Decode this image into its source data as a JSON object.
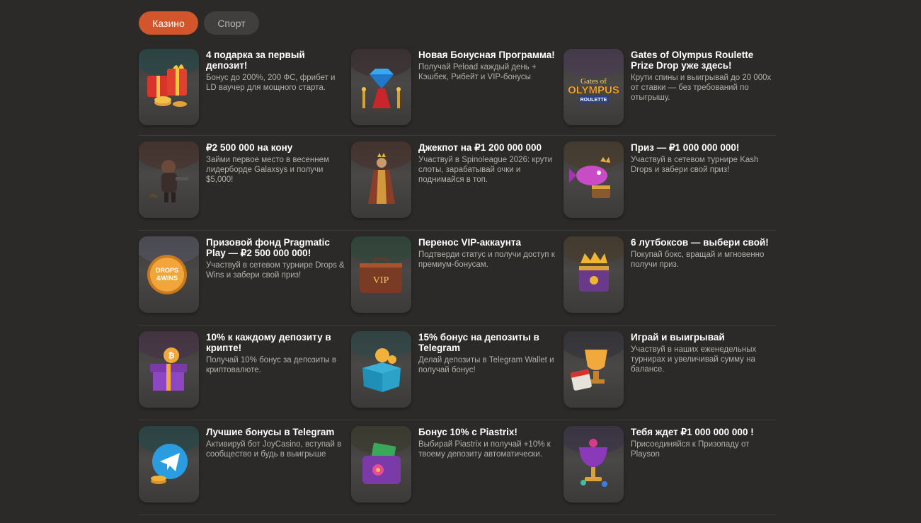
{
  "tabs": {
    "casino": "Казино",
    "sport": "Спорт"
  },
  "cards": [
    {
      "title": "4 подарка за первый депозит!",
      "desc": "Бонус до 200%, 200 ФС, фрибет и LD ваучер для мощного старта.",
      "icon": "gift-boxes-icon"
    },
    {
      "title": "Новая Бонусная Программа!",
      "desc": "Получай Реload каждый день + Кэшбек, Рибейт и VIP-бонусы",
      "icon": "diamond-red-carpet-icon"
    },
    {
      "title": "Gates of Olympus Roulette Prize Drop уже здесь!",
      "desc": "Крути спины и выигрывай до 20 000x от ставки — без требований по отыгрышу.",
      "icon": "olympus-roulette-logo",
      "logo_top": "Gates of",
      "logo_mid": "OLYMPUS",
      "logo_bot": "ROULETTE"
    },
    {
      "title": "₽2 500 000 на кону",
      "desc": "Займи первое место в весеннем лидерборде Galaxsys и получи $5,000!",
      "icon": "character-mascot-icon"
    },
    {
      "title": "Джекпот на ₽1 200 000 000",
      "desc": "Участвуй в Spinoleague 2026: крути слоты, зарабатывай очки и поднимайся в топ.",
      "icon": "queen-figure-icon"
    },
    {
      "title": "Приз — ₽1 000 000 000!",
      "desc": "Участвуй в сетевом турнире Kash Drops и забери свой приз!",
      "icon": "pink-fish-chest-icon"
    },
    {
      "title": "Призовой фонд Pragmatic Play — ₽2 500 000 000!",
      "desc": "Участвуй в сетевом турнире Drops & Wins и забери свой приз!",
      "icon": "drops-wins-coin-icon",
      "logo_top": "DROPS",
      "logo_bot": "&WINS"
    },
    {
      "title": "Перенос VIP-аккаунта",
      "desc": "Подтверди статус и получи доступ к премиум-бонусам.",
      "icon": "vip-suitcase-icon",
      "logo_mid": "VIP"
    },
    {
      "title": "6 лутбоксов — выбери свой!",
      "desc": "Покупай бокс, вращай и мгновенно получи приз.",
      "icon": "crown-lootbox-icon"
    },
    {
      "title": "10% к каждому депозиту в крипте!",
      "desc": "Получай 10% бонус за депозиты в криптовалюте.",
      "icon": "crypto-gift-box-icon"
    },
    {
      "title": "15% бонус на депозиты в Telegram",
      "desc": "Делай депозиты в Telegram Wallet и получай бонус!",
      "icon": "telegram-gift-box-icon"
    },
    {
      "title": "Играй и выигрывай",
      "desc": "Участвуй в наших еженедельных турнирах и увеличивай сумму на балансе.",
      "icon": "trophy-weekly-icon"
    },
    {
      "title": "Лучшие бонусы в Telegram",
      "desc": "Активируй бот JoyCasino, вступай в сообщество и будь в выигрыше",
      "icon": "telegram-coins-icon"
    },
    {
      "title": "Бонус 10% с Piastrix!",
      "desc": "Выбирай Piastrix и получай +10% к твоему депозиту автоматически.",
      "icon": "purple-wallet-icon"
    },
    {
      "title": "Тебя ждет ₽1 000 000 000 !",
      "desc": "Присоединяйся к Призопаду от Playson",
      "icon": "gem-goblet-icon"
    }
  ]
}
